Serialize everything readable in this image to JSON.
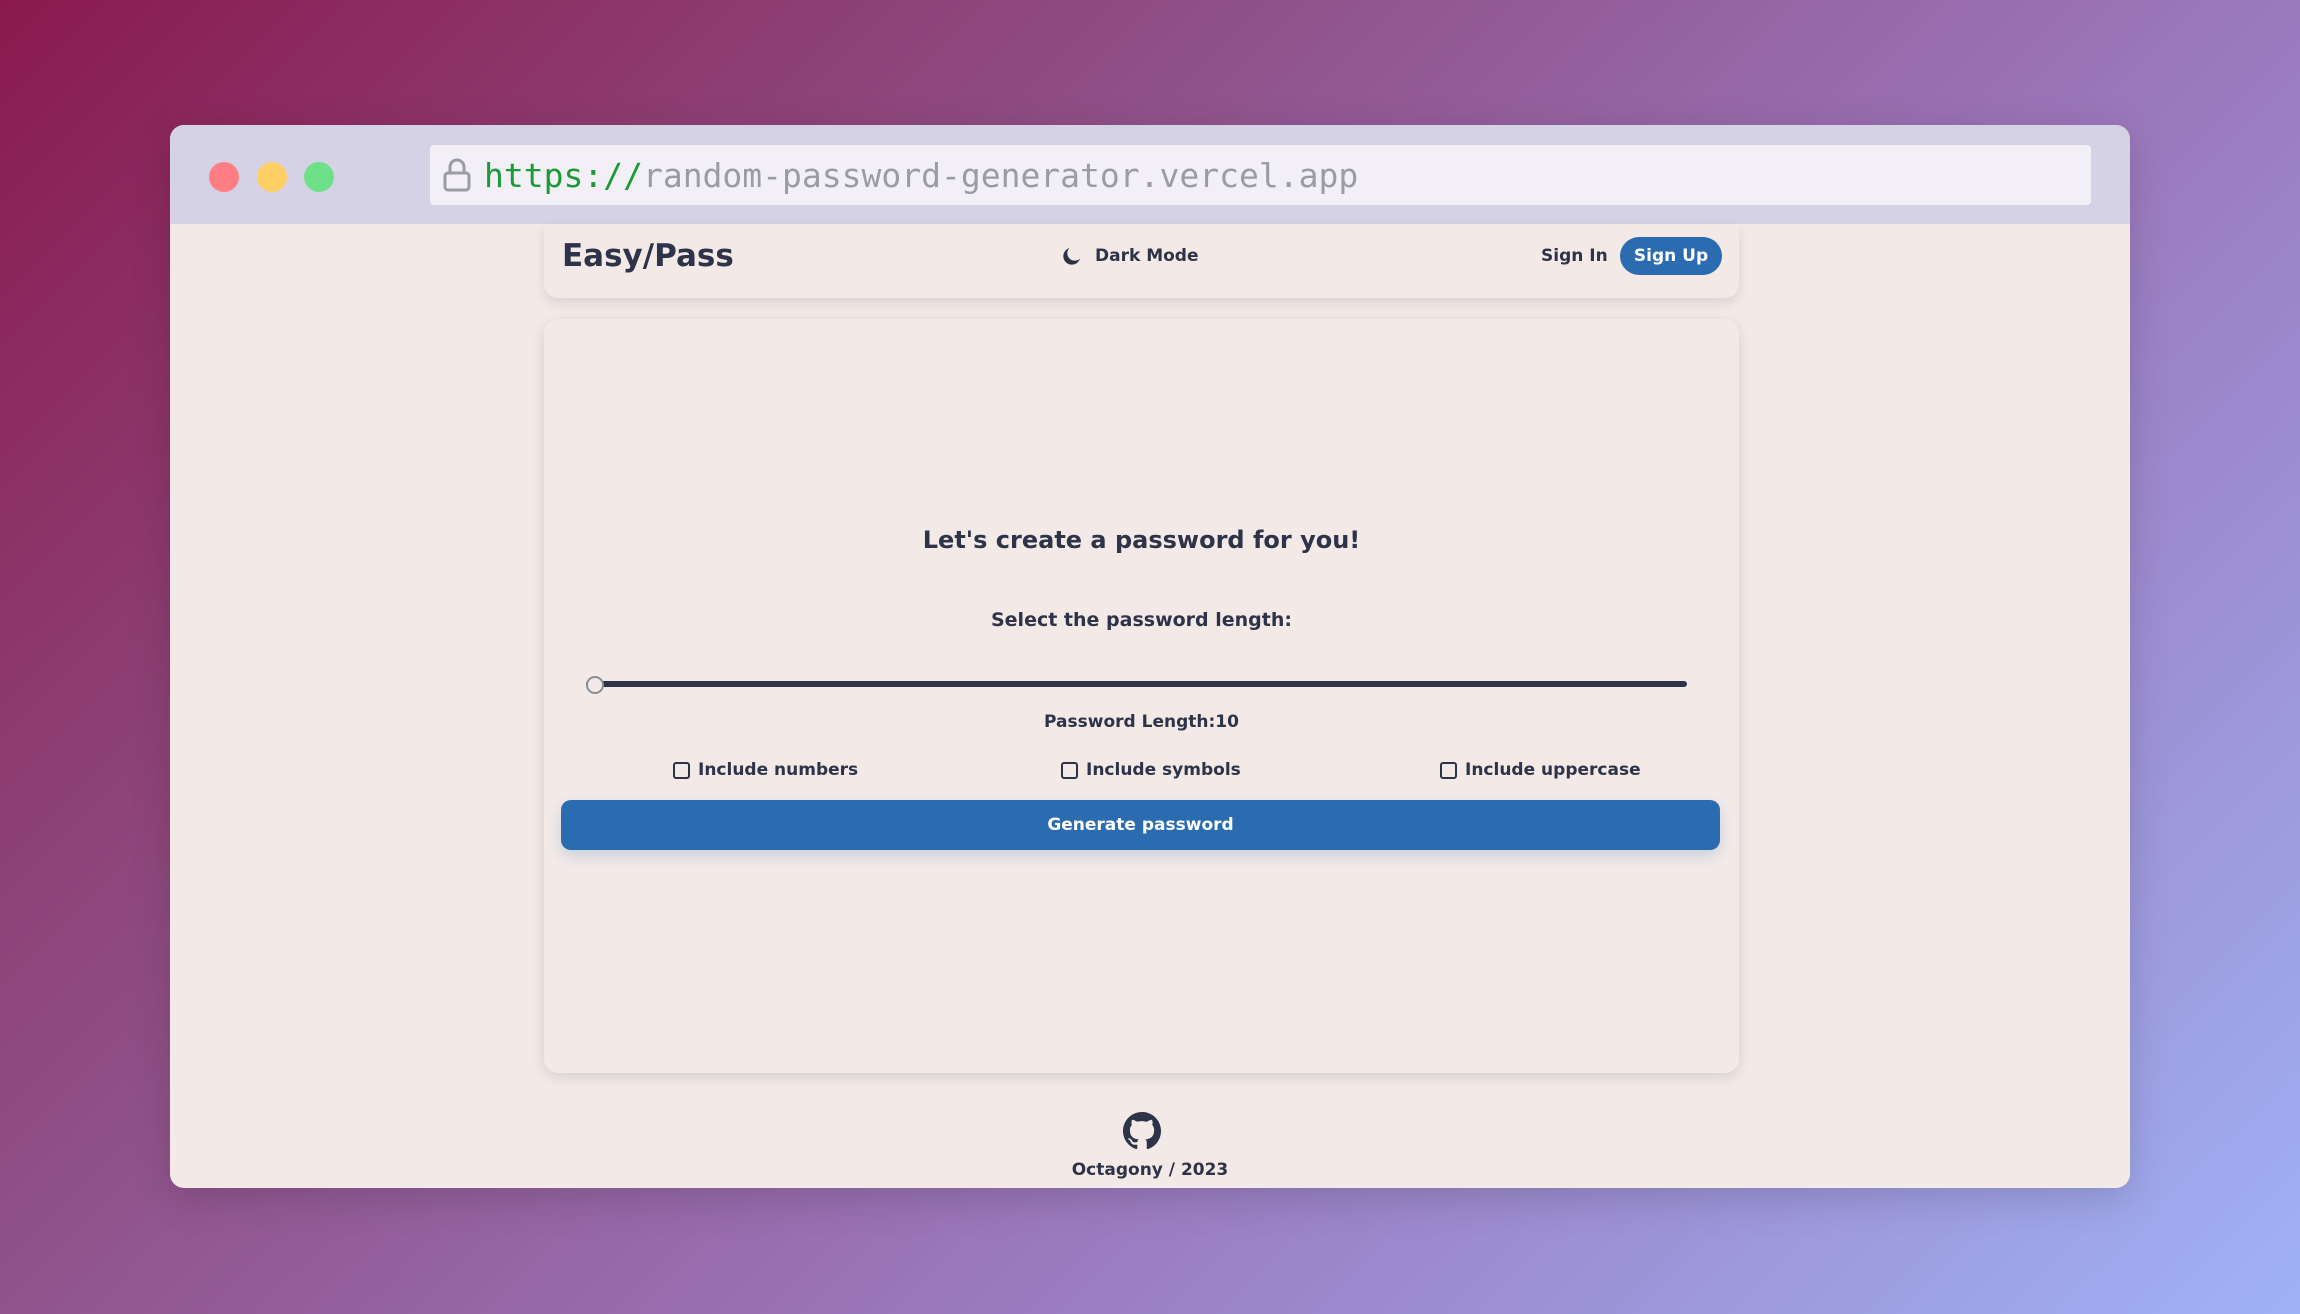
{
  "browser": {
    "url_protocol": "https://",
    "url_host": "random-password-generator.vercel.app"
  },
  "navbar": {
    "brand": "Easy/Pass",
    "dark_mode_label": "Dark Mode",
    "sign_in_label": "Sign In",
    "sign_up_label": "Sign Up"
  },
  "generator": {
    "title": "Let's create a password for you!",
    "length_prompt": "Select the password length:",
    "slider_value_fraction": 0.0,
    "length_readout": "Password Length:10",
    "options": {
      "numbers": {
        "label": "Include numbers",
        "checked": false
      },
      "symbols": {
        "label": "Include symbols",
        "checked": false
      },
      "uppercase": {
        "label": "Include uppercase",
        "checked": false
      }
    },
    "generate_label": "Generate password"
  },
  "footer": {
    "icon": "github-icon",
    "text": "Octagony / 2023"
  },
  "colors": {
    "accent": "#2b6cb0",
    "text": "#2d3348",
    "page_bg": "#f3eae8",
    "url_protocol": "#1c9a35"
  }
}
